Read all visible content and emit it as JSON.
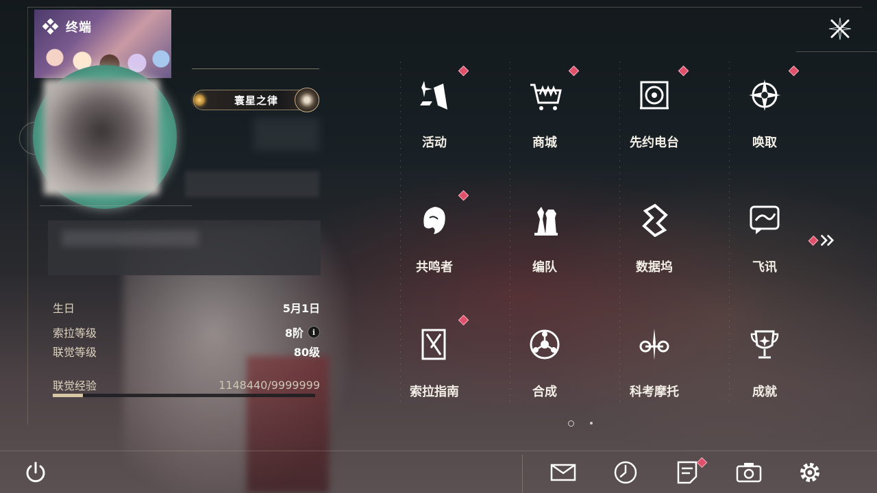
{
  "header": {
    "title": "终端"
  },
  "profile": {
    "honor_title": "寰星之律",
    "stats": [
      {
        "label": "生日",
        "value": "5月1日"
      },
      {
        "label": "索拉等级",
        "value": "8阶"
      },
      {
        "label": "联觉等级",
        "value": "80级"
      },
      {
        "label": "联觉经验",
        "value": "1148440/9999999"
      }
    ],
    "xp_progress": 0.115
  },
  "menu": {
    "tiles": [
      {
        "label": "活动",
        "icon": "sparkle-flag-icon",
        "badge": true
      },
      {
        "label": "商城",
        "icon": "shopping-cart-icon",
        "badge": true
      },
      {
        "label": "先约电台",
        "icon": "radio-player-icon",
        "badge": true
      },
      {
        "label": "唤取",
        "icon": "compass-star-icon",
        "badge": true
      },
      {
        "label": "共鸣者",
        "icon": "character-portrait-icon",
        "badge": true
      },
      {
        "label": "编队",
        "icon": "chess-pieces-icon",
        "badge": false
      },
      {
        "label": "数据坞",
        "icon": "data-dock-icon",
        "badge": false
      },
      {
        "label": "飞讯",
        "icon": "message-bubble-icon",
        "badge": false
      },
      {
        "label": "索拉指南",
        "icon": "guide-book-icon",
        "badge": true
      },
      {
        "label": "合成",
        "icon": "synthesis-ring-icon",
        "badge": false
      },
      {
        "label": "科考摩托",
        "icon": "motorbike-icon",
        "badge": false
      },
      {
        "label": "成就",
        "icon": "trophy-icon",
        "badge": false
      }
    ],
    "next_page_badge": true,
    "pagination": {
      "current": 1,
      "total": 2
    }
  },
  "bottom_bar": {
    "icons": [
      "power-icon",
      "mail-icon",
      "clock-icon",
      "notes-icon",
      "camera-icon",
      "settings-icon"
    ],
    "notes_badge": true
  },
  "colors": {
    "badge": "#e0506a",
    "accent": "#d9c6a4",
    "text": "#f3efe6"
  }
}
